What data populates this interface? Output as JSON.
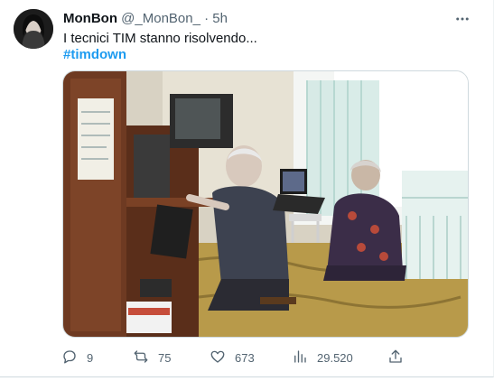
{
  "tweet": {
    "author_name": "MonBon",
    "handle": "@_MonBon_",
    "separator": "·",
    "time": "5h",
    "text": "I tecnici TIM stanno risolvendo...",
    "hashtag": "#timdown"
  },
  "actions": {
    "replies": "9",
    "retweets": "75",
    "likes": "673",
    "views": "29.520"
  },
  "icons": {
    "more": "more-icon",
    "reply": "reply-icon",
    "retweet": "retweet-icon",
    "like": "heart-icon",
    "views": "views-icon",
    "share": "share-icon"
  },
  "colors": {
    "link": "#1d9bf0",
    "secondary_text": "#536471",
    "primary_text": "#0f1419"
  }
}
